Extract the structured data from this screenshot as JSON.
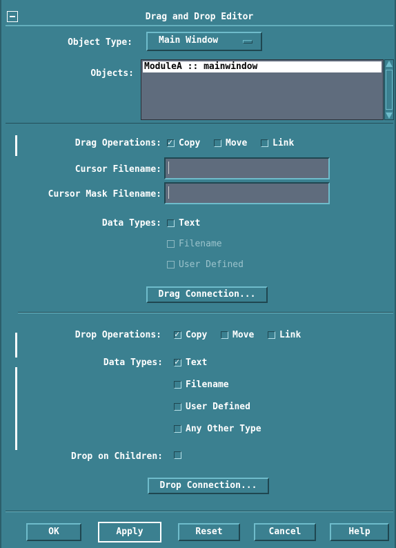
{
  "window": {
    "title": "Drag and Drop Editor"
  },
  "object": {
    "type_label": "Object Type:",
    "type_value": "Main Window",
    "objects_label": "Objects:",
    "objects_list": [
      "ModuleA :: mainwindow"
    ]
  },
  "drag": {
    "operations_label": "Drag Operations:",
    "operations": [
      {
        "label": "Copy",
        "checked": true
      },
      {
        "label": "Move",
        "checked": false
      },
      {
        "label": "Link",
        "checked": false
      }
    ],
    "cursor_filename_label": "Cursor Filename:",
    "cursor_filename_value": "",
    "cursor_mask_label": "Cursor Mask Filename:",
    "cursor_mask_value": "",
    "data_types_label": "Data Types:",
    "data_types": [
      {
        "label": "Text",
        "checked": false,
        "enabled": true
      },
      {
        "label": "Filename",
        "checked": false,
        "enabled": false
      },
      {
        "label": "User Defined",
        "checked": false,
        "enabled": false
      }
    ],
    "connection_button": "Drag Connection..."
  },
  "drop": {
    "operations_label": "Drop Operations:",
    "operations": [
      {
        "label": "Copy",
        "checked": true
      },
      {
        "label": "Move",
        "checked": false
      },
      {
        "label": "Link",
        "checked": false
      }
    ],
    "data_types_label": "Data Types:",
    "data_types": [
      {
        "label": "Text",
        "checked": true
      },
      {
        "label": "Filename",
        "checked": false
      },
      {
        "label": "User Defined",
        "checked": false
      },
      {
        "label": "Any Other Type",
        "checked": false
      }
    ],
    "children_label": "Drop on Children:",
    "children_checked": false,
    "connection_button": "Drop Connection..."
  },
  "buttons": {
    "ok": "OK",
    "apply": "Apply",
    "reset": "Reset",
    "cancel": "Cancel",
    "help": "Help"
  },
  "colors": {
    "background": "#3b8090",
    "field": "#5f6c7d",
    "text": "#ffffff"
  }
}
